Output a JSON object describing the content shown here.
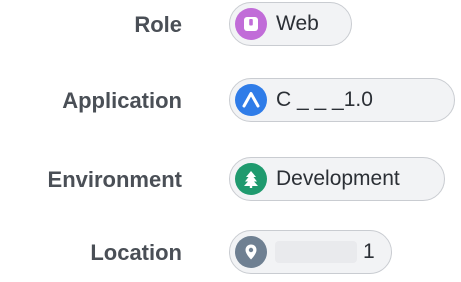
{
  "fields": [
    {
      "label": "Role",
      "value": "Web",
      "icon": "role-icon",
      "color": "#c16cd8"
    },
    {
      "label": "Application",
      "value": "C  _  _  _1.0",
      "icon": "application-icon",
      "color": "#2f7ce8"
    },
    {
      "label": "Environment",
      "value": "Development",
      "icon": "tree-icon",
      "color": "#1f9a6e"
    },
    {
      "label": "Location",
      "value": "1",
      "icon": "map-pin-icon",
      "color": "#6f8092"
    }
  ]
}
